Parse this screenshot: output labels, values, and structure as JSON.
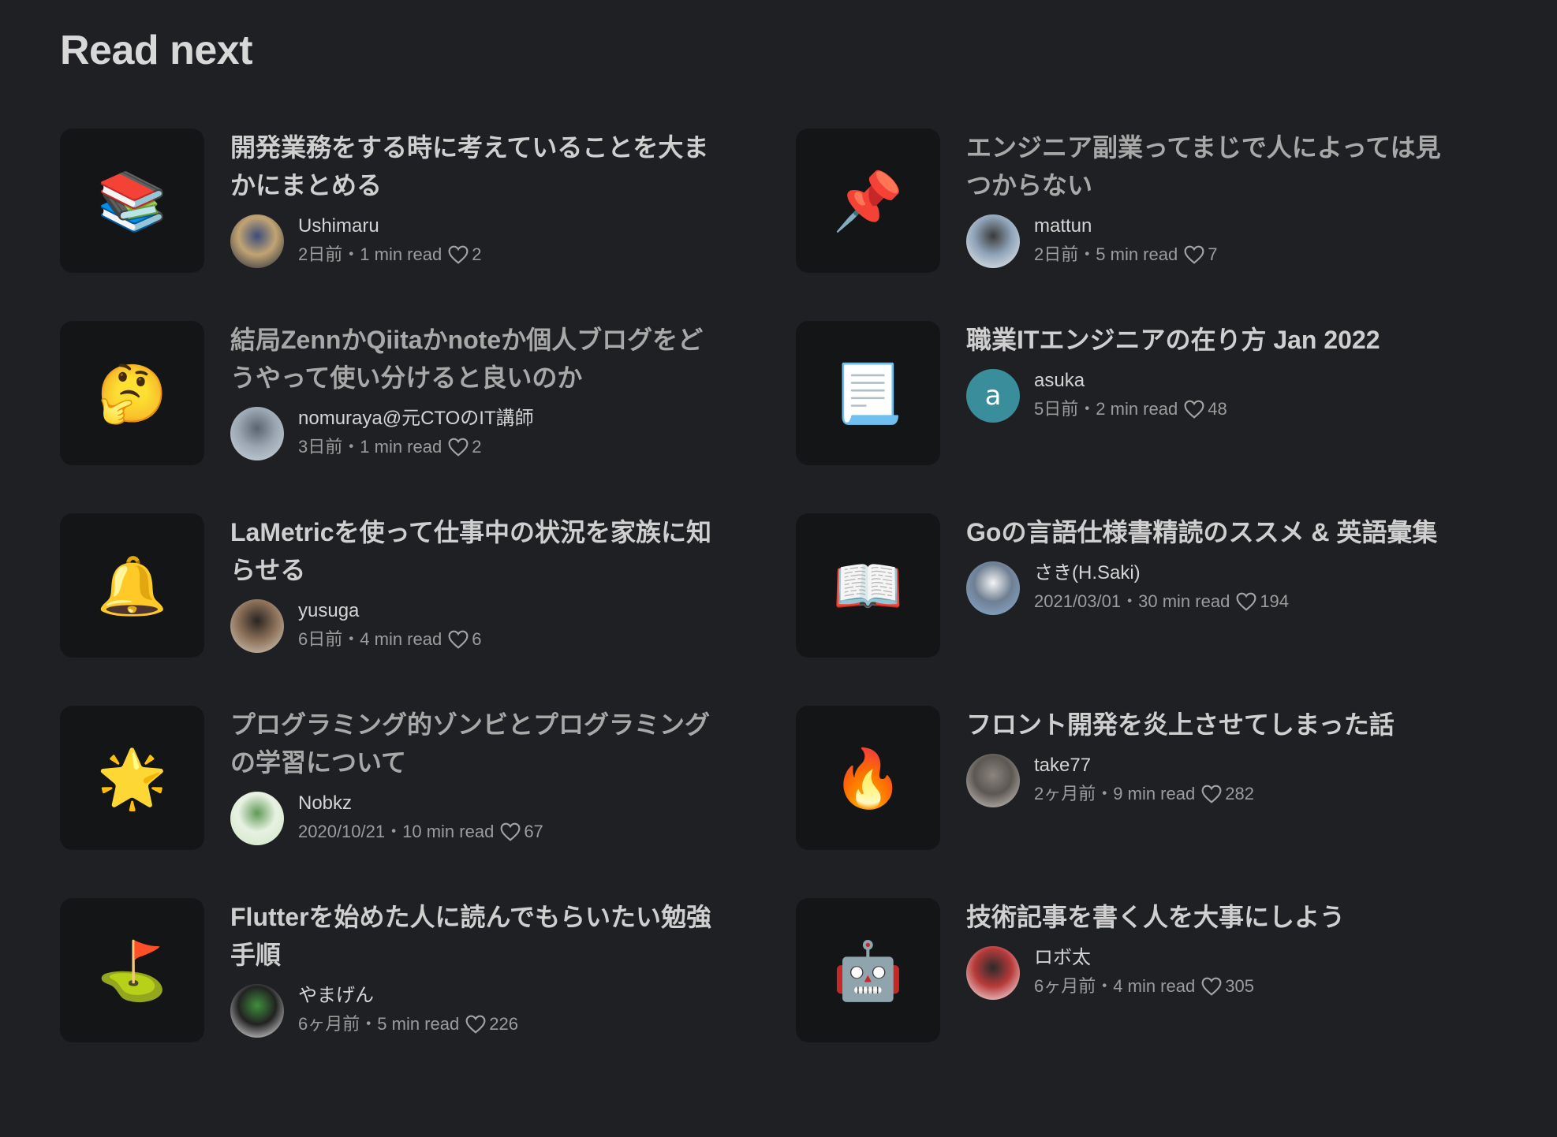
{
  "section": {
    "title": "Read next"
  },
  "articles": [
    {
      "emoji": "📚",
      "title": "開発業務をする時に考えていることを大まかにまとめる",
      "author": "Ushimaru",
      "date": "2日前",
      "read_time": "1 min read",
      "likes": "2",
      "separator": "・",
      "avatar": {
        "letter": "",
        "colors": [
          "#1b2438",
          "#3b4d7a",
          "#c2a473"
        ]
      }
    },
    {
      "emoji": "📌",
      "title": "エンジニア副業ってまじで人によっては見つからない",
      "author": "mattun",
      "date": "2日前",
      "read_time": "5 min read",
      "likes": "7",
      "separator": "・",
      "avatar": {
        "letter": "",
        "colors": [
          "#f2f2f2",
          "#3a3a3a",
          "#8fa3b8"
        ]
      }
    },
    {
      "emoji": "🤔",
      "title": "結局ZennかQiitaかnoteか個人ブログをどうやって使い分けると良いのか",
      "author": "nomuraya@元CTOのIT講師",
      "date": "3日前",
      "read_time": "1 min read",
      "likes": "2",
      "separator": "・",
      "avatar": {
        "letter": "",
        "colors": [
          "#cfd6de",
          "#5b6470",
          "#9aa6b2"
        ]
      }
    },
    {
      "emoji": "📃",
      "title": "職業ITエンジニアの在り方 Jan 2022",
      "author": "asuka",
      "date": "5日前",
      "read_time": "2 min read",
      "likes": "48",
      "separator": "・",
      "avatar": {
        "letter": "a",
        "colors": [
          "#3a8d9a",
          "#3a8d9a",
          "#3a8d9a"
        ]
      }
    },
    {
      "emoji": "🔔",
      "title": "LaMetricを使って仕事中の状況を家族に知らせる",
      "author": "yusuga",
      "date": "6日前",
      "read_time": "4 min read",
      "likes": "6",
      "separator": "・",
      "avatar": {
        "letter": "",
        "colors": [
          "#d9cfc2",
          "#2a2420",
          "#8a6f58"
        ]
      }
    },
    {
      "emoji": "📖",
      "title": "Goの言語仕様書精読のススメ & 英語彙集",
      "author": "さき(H.Saki)",
      "date": "2021/03/01",
      "read_time": "30 min read",
      "likes": "194",
      "separator": "・",
      "avatar": {
        "letter": "",
        "colors": [
          "#8db0d6",
          "#f4f4f4",
          "#6f7f93"
        ]
      }
    },
    {
      "emoji": "🌟",
      "title": "プログラミング的ゾンビとプログラミングの学習について",
      "author": "Nobkz",
      "date": "2020/10/21",
      "read_time": "10 min read",
      "likes": "67",
      "separator": "・",
      "avatar": {
        "letter": "",
        "colors": [
          "#cfe6c4",
          "#5f9a57",
          "#e8f1e2"
        ]
      }
    },
    {
      "emoji": "🔥",
      "title": "フロント開発を炎上させてしまった話",
      "author": "take77",
      "date": "2ヶ月前",
      "read_time": "9 min read",
      "likes": "282",
      "separator": "・",
      "avatar": {
        "letter": "",
        "colors": [
          "#d7d2cc",
          "#8a847d",
          "#5c5752"
        ]
      }
    },
    {
      "emoji": "⛳",
      "title": "Flutterを始めた人に読んでもらいたい勉強手順",
      "author": "やまげん",
      "date": "6ヶ月前",
      "read_time": "5 min read",
      "likes": "226",
      "separator": "・",
      "avatar": {
        "letter": "",
        "colors": [
          "#ffffff",
          "#3f8f3c",
          "#222222"
        ]
      }
    },
    {
      "emoji": "🤖",
      "title": "技術記事を書く人を大事にしよう",
      "author": "ロボ太",
      "date": "6ヶ月前",
      "read_time": "4 min read",
      "likes": "305",
      "separator": "・",
      "avatar": {
        "letter": "",
        "colors": [
          "#ffffff",
          "#2b2b2b",
          "#b83a3a"
        ]
      }
    }
  ],
  "style": {
    "background": "#1f2023",
    "card_thumb_bg": "#141517",
    "title_color": "#cfcfcf",
    "title_dim_color": "#a8a8a8",
    "meta_color": "#9c9c9c"
  }
}
